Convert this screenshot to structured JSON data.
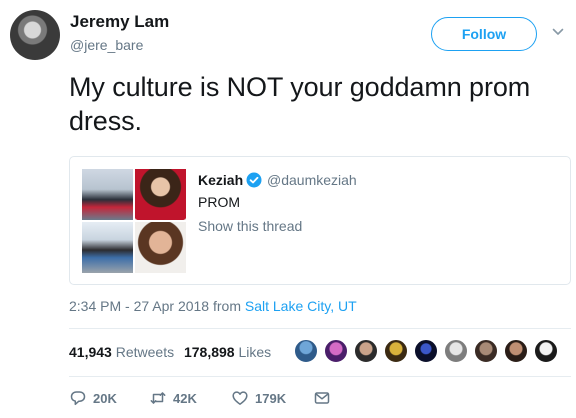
{
  "author": {
    "name": "Jeremy Lam",
    "handle": "@jere_bare",
    "follow_label": "Follow"
  },
  "tweet": {
    "text": "My culture is NOT your goddamn prom dress."
  },
  "quoted_tweet": {
    "name": "Keziah",
    "handle": "@daumkeziah",
    "text": "PROM",
    "thread_label": "Show this thread"
  },
  "meta": {
    "time": "2:34 PM - 27 Apr 2018 from ",
    "location": "Salt Lake City, UT"
  },
  "stats": {
    "retweets_count": "41,943",
    "retweets_label": "Retweets",
    "likes_count": "178,898",
    "likes_label": "Likes"
  },
  "actions": {
    "reply_count": "20K",
    "retweet_count": "42K",
    "like_count": "179K"
  },
  "colors": {
    "accent": "#1da1f2",
    "secondary_text": "#657786",
    "primary_text": "#14171a"
  }
}
